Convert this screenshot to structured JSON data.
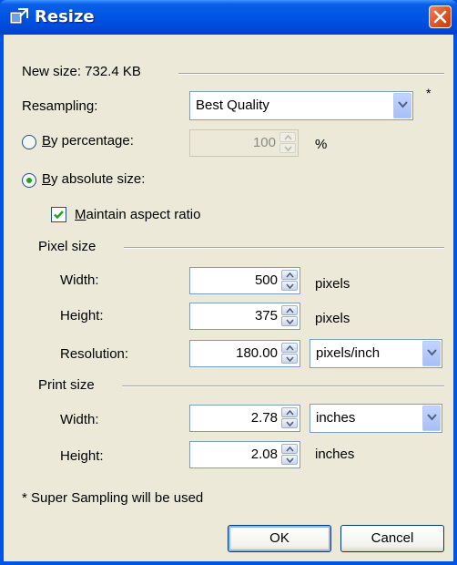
{
  "window": {
    "title": "Resize"
  },
  "header": {
    "new_size": "New size: 732.4 KB"
  },
  "resampling": {
    "label": "Resampling:",
    "value": "Best Quality",
    "asterisk": "*"
  },
  "by_percentage": {
    "label": "By percentage:",
    "value": "100",
    "unit": "%",
    "selected": false
  },
  "by_absolute": {
    "label": "By absolute size:",
    "selected": true
  },
  "maintain_aspect": {
    "label": "Maintain aspect ratio",
    "checked": true
  },
  "pixel_size": {
    "heading": "Pixel size",
    "width": {
      "label": "Width:",
      "value": "500",
      "unit": "pixels"
    },
    "height": {
      "label": "Height:",
      "value": "375",
      "unit": "pixels"
    },
    "resolution": {
      "label": "Resolution:",
      "value": "180.00",
      "unit": "pixels/inch"
    }
  },
  "print_size": {
    "heading": "Print size",
    "width": {
      "label": "Width:",
      "value": "2.78",
      "unit": "inches"
    },
    "height": {
      "label": "Height:",
      "value": "2.08",
      "unit": "inches"
    }
  },
  "footnote": "* Super Sampling will be used",
  "buttons": {
    "ok": "OK",
    "cancel": "Cancel"
  }
}
